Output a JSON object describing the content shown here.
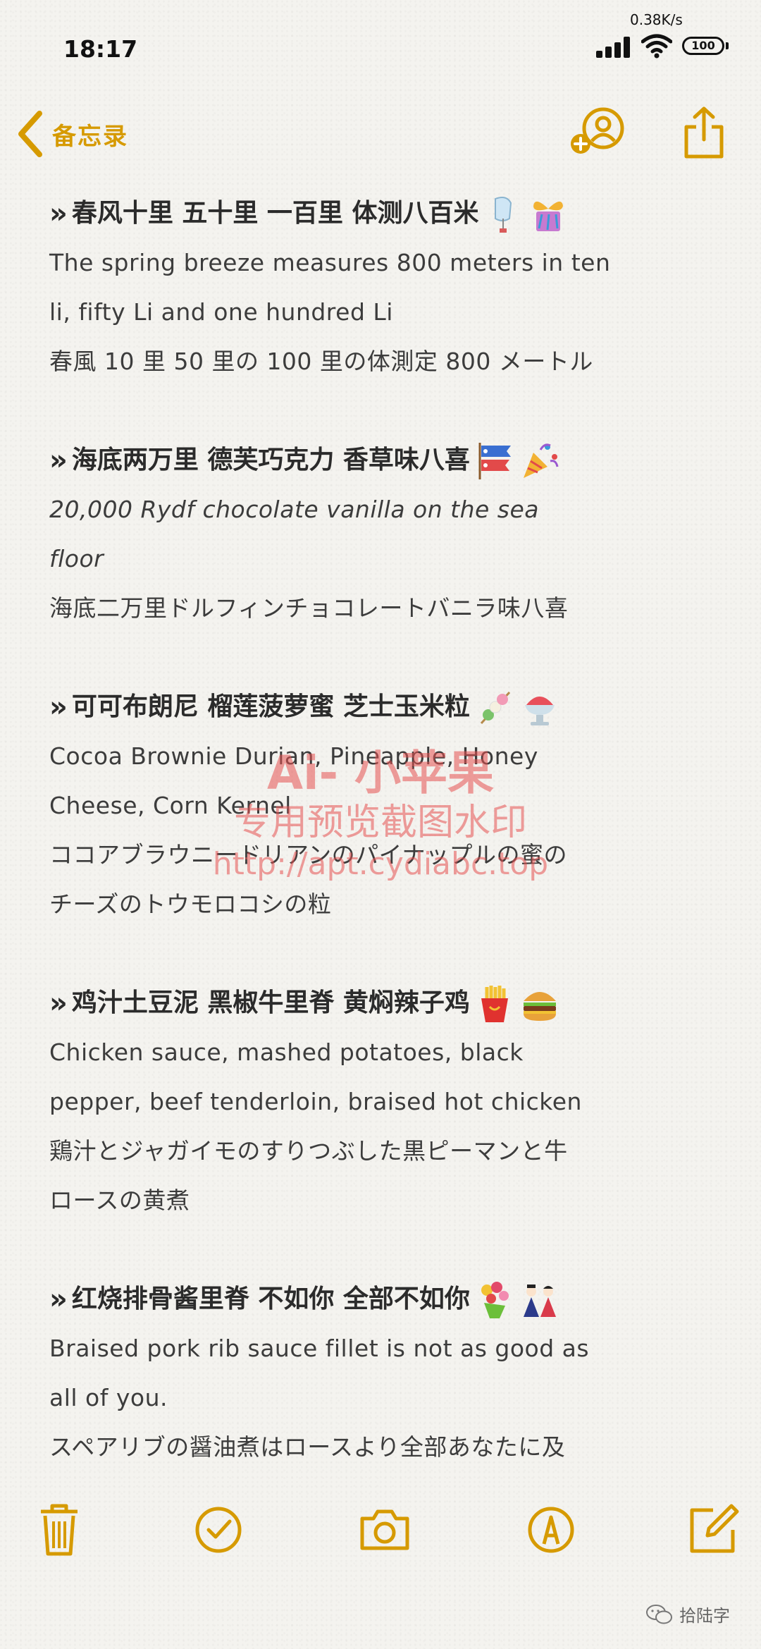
{
  "status_bar": {
    "time": "18:17",
    "net_speed": "0.38K/s",
    "battery": "100"
  },
  "nav": {
    "back_label": "备忘录"
  },
  "entries": [
    {
      "heading": "春风十里 五十里 一百里 体测八百米",
      "emojis": [
        "wind-chime-icon",
        "ribbon-gift-icon"
      ],
      "lines": [
        "The spring breeze measures 800 meters in ten",
        "li, fifty Li and one hundred Li",
        "春風 10 里 50 里の 100 里の体測定 800 メートル"
      ]
    },
    {
      "heading": "海底两万里 德芙巧克力 香草味八喜",
      "emojis": [
        "carp-streamer-icon",
        "party-popper-icon"
      ],
      "lines": [
        "20,000 Rydf chocolate vanilla on the sea",
        "floor",
        "海底二万里ドルフィンチョコレートバニラ味八喜"
      ]
    },
    {
      "heading": "可可布朗尼 榴莲菠萝蜜 芝士玉米粒",
      "emojis": [
        "dango-icon",
        "shaved-ice-icon"
      ],
      "lines": [
        "Cocoa Brownie Durian, Pineapple, Honey",
        "Cheese, Corn Kernel",
        "ココアブラウニードリアンのパイナップルの蜜の",
        "チーズのトウモロコシの粒"
      ]
    },
    {
      "heading": "鸡汁土豆泥 黑椒牛里脊 黄焖辣子鸡",
      "emojis": [
        "french-fries-icon",
        "hamburger-icon"
      ],
      "lines": [
        "Chicken sauce, mashed potatoes, black",
        "pepper, beef tenderloin, braised hot chicken",
        "鶏汁とジャガイモのすりつぶした黒ピーマンと牛",
        "ロースの黄煮"
      ]
    },
    {
      "heading": "红烧排骨酱里脊 不如你 全部不如你",
      "emojis": [
        "bouquet-icon",
        "hina-dolls-icon"
      ],
      "lines": [
        "Braised pork rib sauce fillet is not as good as",
        "all of you.",
        "スペアリブの醤油煮はロースより全部あなたに及"
      ]
    }
  ],
  "watermark": {
    "line1": "Ai- 小苹果",
    "line2": "专用预览截图水印",
    "line3": "http://apt.cydiabc.top"
  },
  "footer": {
    "tag": "拾陆字"
  },
  "colors": {
    "accent": "#d69a00",
    "text": "#3a3a3a",
    "watermark": "#e65050"
  }
}
